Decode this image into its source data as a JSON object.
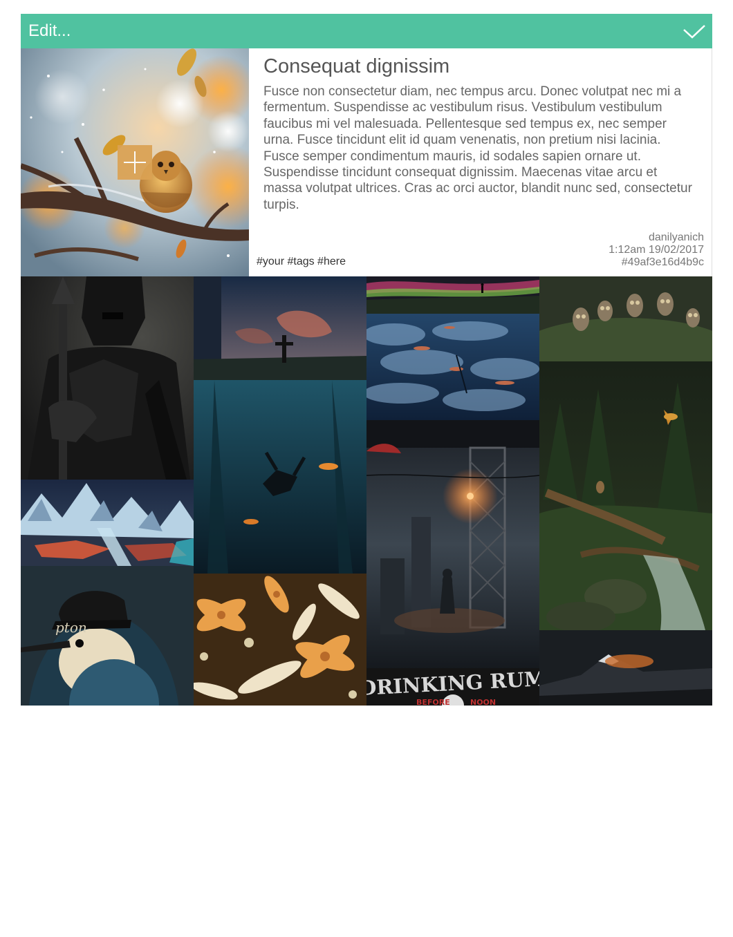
{
  "header": {
    "title": "Edit..."
  },
  "card": {
    "title": "Consequat dignissim",
    "description": "Fusce non consectetur diam, nec tempus arcu. Donec volutpat nec mi a fermentum. Suspendisse ac vestibulum risus. Vestibulum vestibulum faucibus mi vel malesuada. Pellentesque sed tempus ex, nec semper urna. Fusce tincidunt elit id quam venenatis, non pretium nisi lacinia. Fusce semper condimentum mauris, id sodales sapien ornare ut. Suspendisse tincidunt consequat dignissim. Maecenas vitae arcu et massa volutpat ultrices. Cras ac orci auctor, blandit nunc sed, consectetur turpis.",
    "tags": "#your #tags #here",
    "author": "danilyanich",
    "timestamp": "1:12am 19/02/2017",
    "hash": "#49af3e16d4b9c"
  },
  "gallery": {
    "cap_text": "pton",
    "poster_text_top": "DRINKING RUM",
    "poster_text_left": "BEFORE",
    "poster_text_right": "NOON",
    "tiles": [
      "dark-knight-painting",
      "underwater-diver-painting",
      "aurora-horizon-painting",
      "owls-painting",
      "cloud-sea-painting",
      "forest-stream-painting",
      "arctic-lake-painting",
      "rainy-city-painting",
      "bird-with-cap-painting",
      "lily-pattern-painting",
      "drinking-rum-poster",
      "volcano-painting"
    ]
  },
  "colors": {
    "header": "#50c2a0",
    "add_button": "#dba253"
  },
  "icons": [
    "checkmark-icon",
    "plus-icon"
  ]
}
